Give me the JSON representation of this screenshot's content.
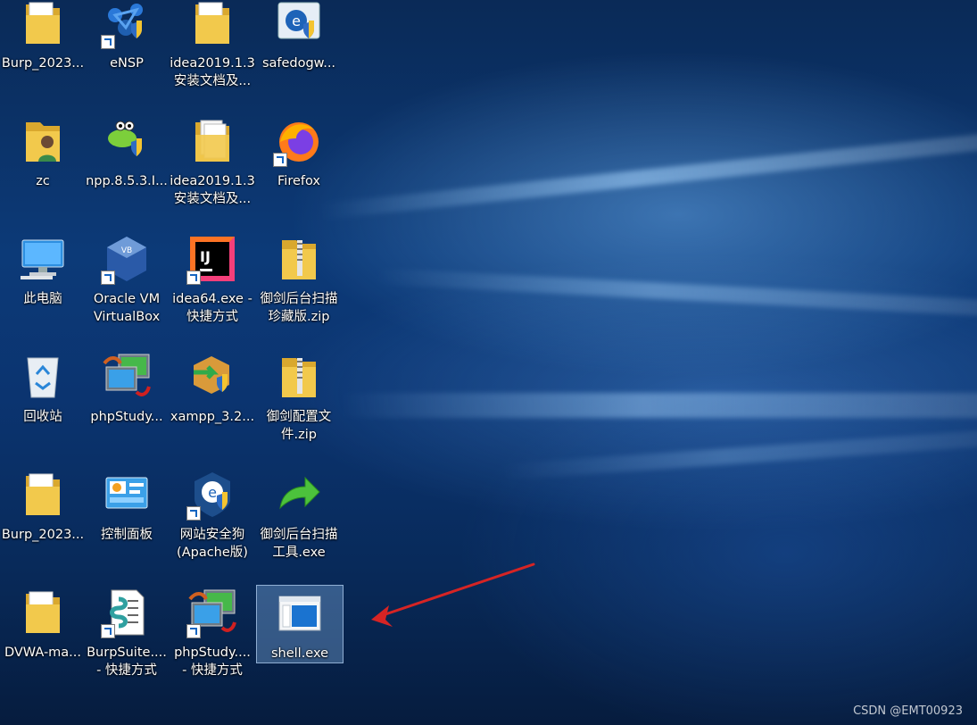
{
  "colors": {
    "folder": "#f2c94c",
    "folder_dark": "#d9a82e",
    "shield_blue": "#2f6cc4",
    "shield_yellow": "#f4c430",
    "arrow_red": "#d62424",
    "firefox_orange": "#ff7a1a",
    "firefox_purple": "#7b3fe4"
  },
  "desktop": {
    "icons": [
      {
        "label": "Burp_2023...",
        "icon": "folder-icon"
      },
      {
        "label": "eNSP",
        "icon": "ensp-icon"
      },
      {
        "label": "idea2019.1.3\n安装文档及...",
        "icon": "folder-icon"
      },
      {
        "label": "safedogw...",
        "icon": "safedog-installer-icon"
      },
      {
        "label": "zc",
        "icon": "user-folder-icon"
      },
      {
        "label": "npp.8.5.3.I...",
        "icon": "notepadpp-installer-icon"
      },
      {
        "label": "idea2019.1.3\n安装文档及...",
        "icon": "documents-folder-icon"
      },
      {
        "label": "Firefox",
        "icon": "firefox-icon"
      },
      {
        "label": "此电脑",
        "icon": "this-pc-icon"
      },
      {
        "label": "Oracle VM\nVirtualBox",
        "icon": "virtualbox-icon"
      },
      {
        "label": "idea64.exe -\n快捷方式",
        "icon": "intellij-icon"
      },
      {
        "label": "御剑后台扫描\n珍藏版.zip",
        "icon": "zip-folder-icon"
      },
      {
        "label": "回收站",
        "icon": "recycle-bin-icon"
      },
      {
        "label": "phpStudy...",
        "icon": "phpstudy-icon"
      },
      {
        "label": "xampp_3.2...",
        "icon": "xampp-installer-icon"
      },
      {
        "label": "御剑配置文\n件.zip",
        "icon": "zip-folder-icon"
      },
      {
        "label": "Burp_2023...",
        "icon": "folder-icon"
      },
      {
        "label": "控制面板",
        "icon": "control-panel-icon"
      },
      {
        "label": "网站安全狗\n(Apache版)",
        "icon": "safedog-icon"
      },
      {
        "label": "御剑后台扫描\n工具.exe",
        "icon": "green-arrow-icon"
      },
      {
        "label": "DVWA-ma...",
        "icon": "folder-icon"
      },
      {
        "label": "BurpSuite....\n- 快捷方式",
        "icon": "burpsuite-script-icon"
      },
      {
        "label": "phpStudy....\n- 快捷方式",
        "icon": "phpstudy-icon"
      },
      {
        "label": "shell.exe",
        "icon": "exe-window-icon"
      }
    ]
  },
  "watermark": "CSDN @EMT00923"
}
